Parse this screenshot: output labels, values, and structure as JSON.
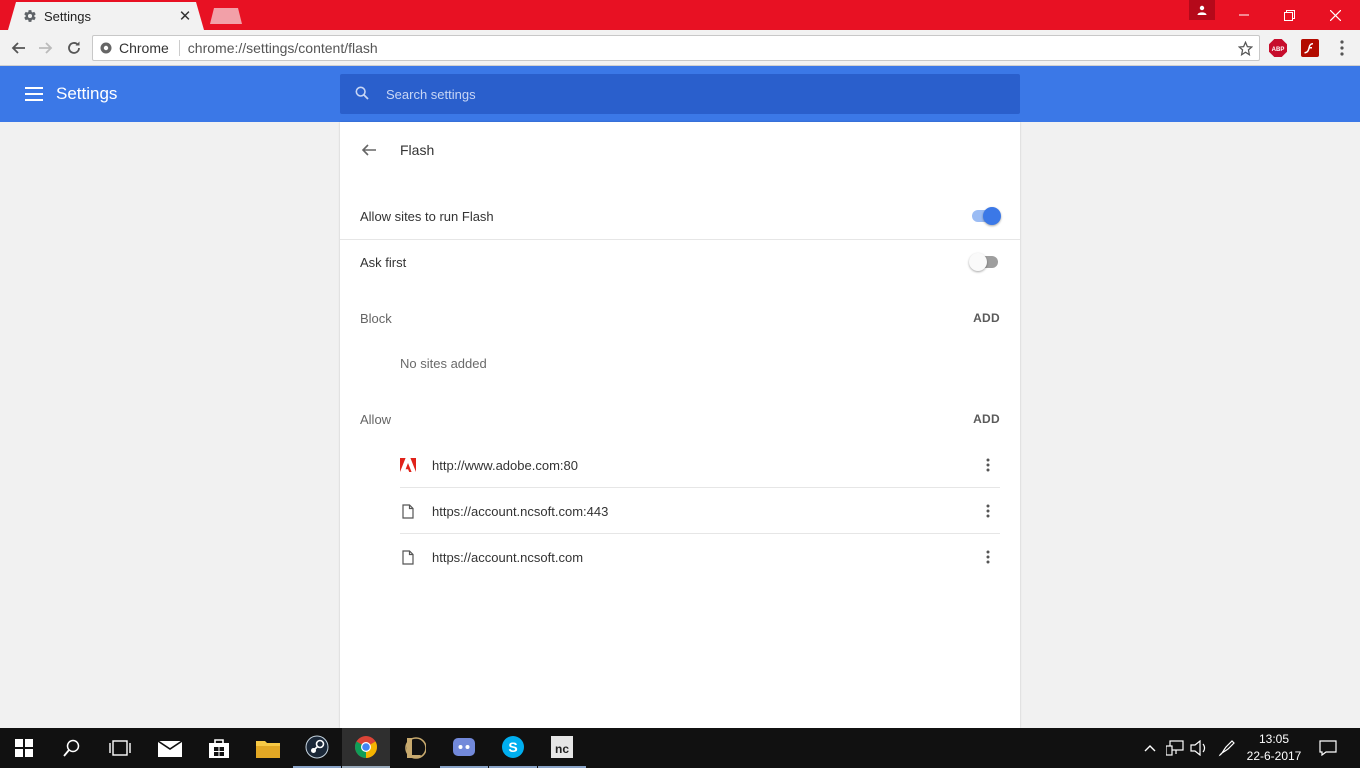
{
  "tab": {
    "title": "Settings"
  },
  "omnibox": {
    "chip": "Chrome",
    "url": "chrome://settings/content/flash"
  },
  "header": {
    "title": "Settings",
    "search_placeholder": "Search settings"
  },
  "page": {
    "title": "Flash",
    "allow_flash": {
      "label": "Allow sites to run Flash",
      "on": true
    },
    "ask_first": {
      "label": "Ask first",
      "on": false
    },
    "block": {
      "title": "Block",
      "add": "ADD",
      "empty": "No sites added"
    },
    "allow": {
      "title": "Allow",
      "add": "ADD",
      "sites": [
        {
          "url": "http://www.adobe.com:80",
          "icon": "adobe-icon"
        },
        {
          "url": "https://account.ncsoft.com:443",
          "icon": "page-icon"
        },
        {
          "url": "https://account.ncsoft.com",
          "icon": "page-icon"
        }
      ]
    }
  },
  "taskbar": {
    "time": "13:05",
    "date": "22-6-2017"
  },
  "colors": {
    "titlebar": "#e81123",
    "header": "#3b78e7",
    "search": "#2a5fcc",
    "toggle_on": "#3b78e7"
  }
}
